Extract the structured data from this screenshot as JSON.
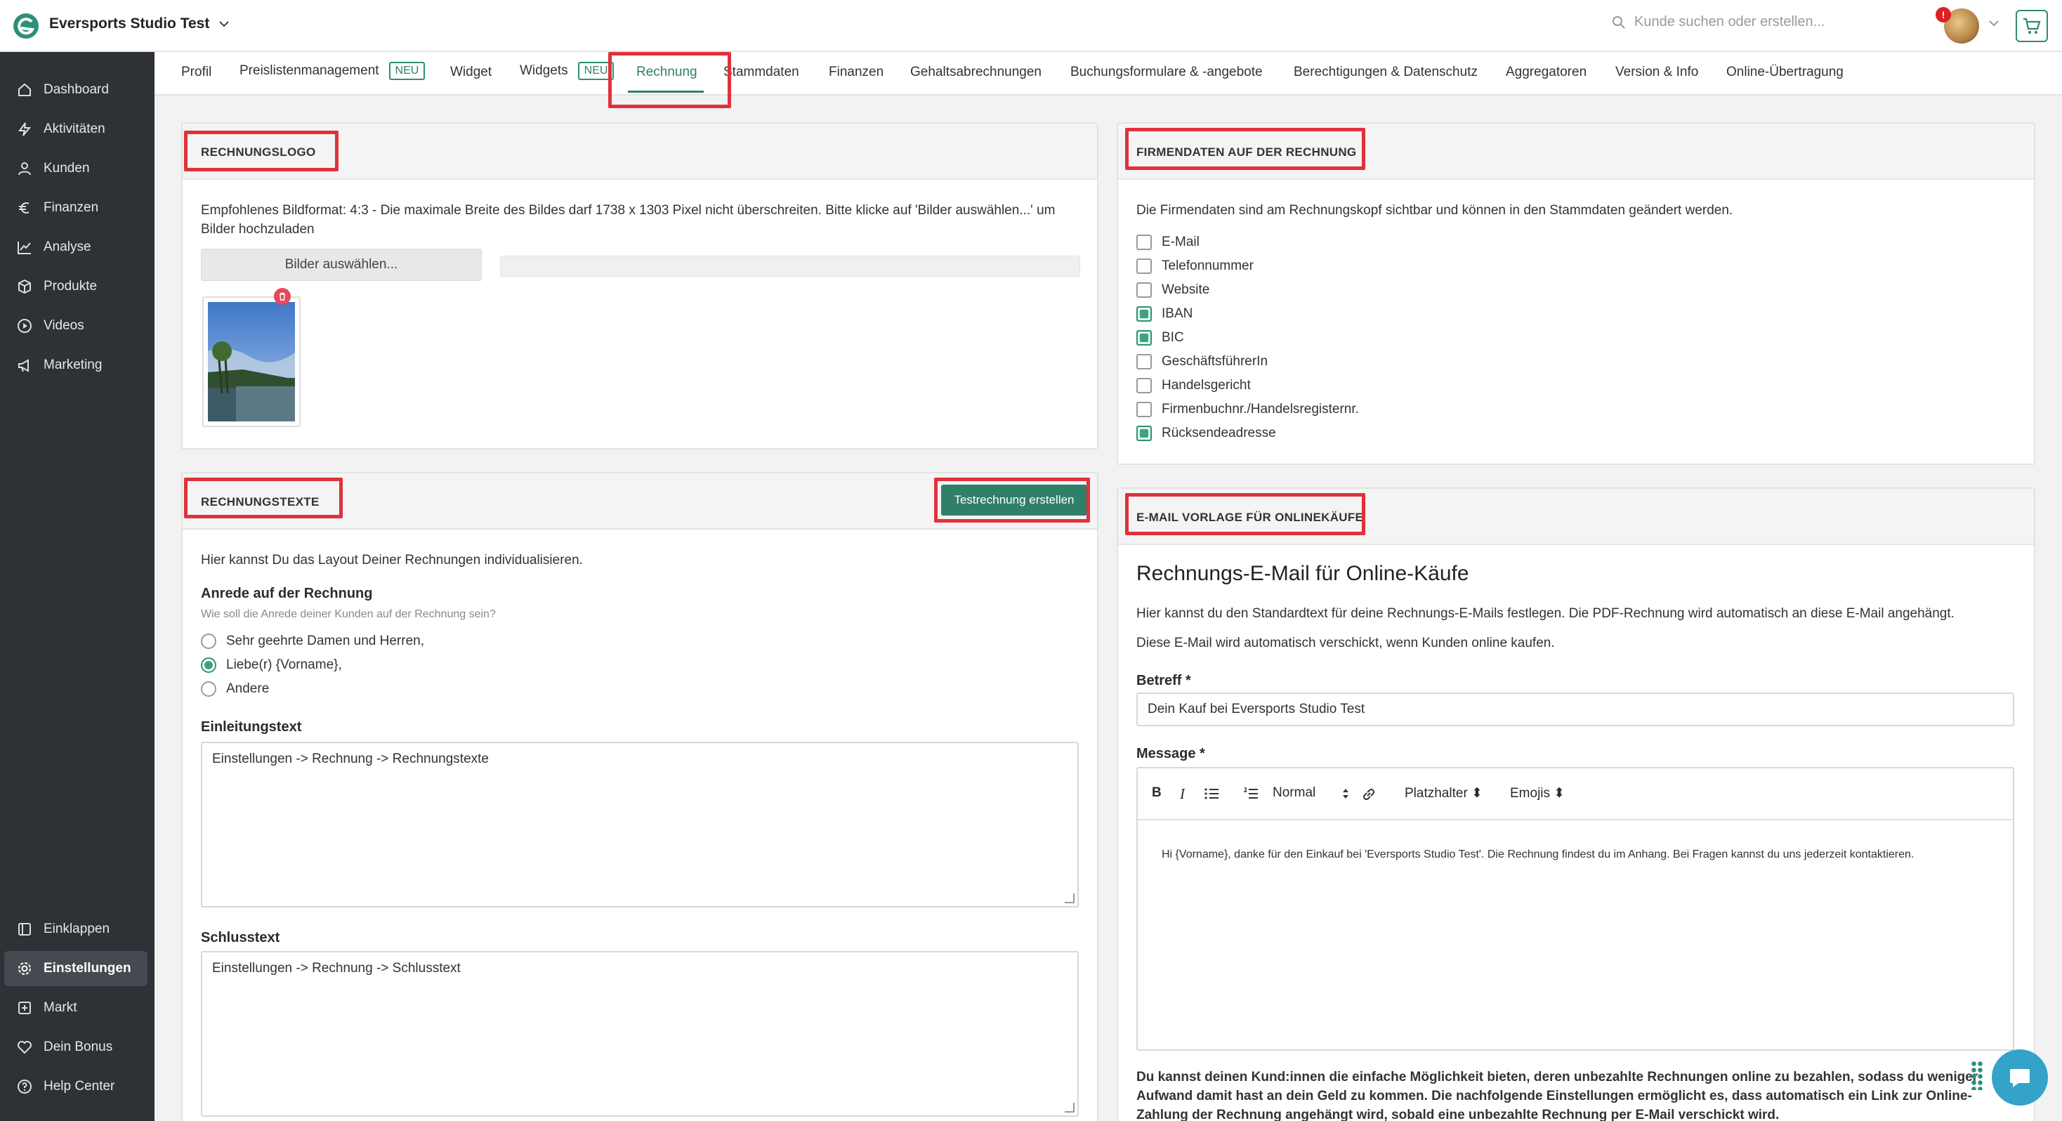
{
  "app": {
    "studio_name": "Eversports Studio Test"
  },
  "search": {
    "placeholder": "Kunde suchen oder erstellen..."
  },
  "notifications": {
    "count": "!"
  },
  "sidebar": {
    "items": [
      {
        "label": "Dashboard",
        "icon": "home-icon"
      },
      {
        "label": "Aktivitäten",
        "icon": "bolt-icon"
      },
      {
        "label": "Kunden",
        "icon": "user-icon"
      },
      {
        "label": "Finanzen",
        "icon": "euro-icon"
      },
      {
        "label": "Analyse",
        "icon": "chart-icon"
      },
      {
        "label": "Produkte",
        "icon": "box-icon"
      },
      {
        "label": "Videos",
        "icon": "play-icon"
      },
      {
        "label": "Marketing",
        "icon": "megaphone-icon"
      }
    ],
    "bottom": [
      {
        "label": "Einklappen",
        "icon": "collapse-icon"
      },
      {
        "label": "Einstellungen",
        "icon": "gear-icon"
      },
      {
        "label": "Markt",
        "icon": "plus-square-icon"
      },
      {
        "label": "Dein Bonus",
        "icon": "heart-icon"
      },
      {
        "label": "Help Center",
        "icon": "help-icon"
      }
    ]
  },
  "tabs": [
    {
      "label": "Profil"
    },
    {
      "label": "Preislistenmanagement",
      "badge": "NEU"
    },
    {
      "label": "Widget"
    },
    {
      "label": "Widgets",
      "badge": "NEU"
    },
    {
      "label": "Rechnung"
    },
    {
      "label": "Stammdaten"
    },
    {
      "label": "Finanzen"
    },
    {
      "label": "Gehaltsabrechnungen"
    },
    {
      "label": "Buchungsformulare & -angebote"
    },
    {
      "label": "Berechtigungen & Datenschutz"
    },
    {
      "label": "Aggregatoren"
    },
    {
      "label": "Version & Info"
    },
    {
      "label": "Online-Übertragung"
    }
  ],
  "logo_card": {
    "title": "RECHNUNGSLOGO",
    "description": "Empfohlenes Bildformat: 4:3 - Die maximale Breite des Bildes darf 1738 x 1303 Pixel nicht überschreiten. Bitte klicke auf 'Bilder auswählen...' um Bilder hochzuladen",
    "select_button": "Bilder auswählen..."
  },
  "texts_card": {
    "title": "RECHNUNGSTEXTE",
    "test_button": "Testrechnung erstellen",
    "intro": "Hier kannst Du das Layout Deiner Rechnungen individualisieren.",
    "salutation_label": "Anrede auf der Rechnung",
    "salutation_help": "Wie soll die Anrede deiner Kunden auf der Rechnung sein?",
    "salutation_options": [
      {
        "label": "Sehr geehrte Damen und Herren,",
        "selected": false
      },
      {
        "label": "Liebe(r) {Vorname},",
        "selected": true
      },
      {
        "label": "Andere",
        "selected": false
      }
    ],
    "intro_text_label": "Einleitungstext",
    "intro_text_value": "Einstellungen  -> Rechnung -> Rechnungstexte",
    "closing_text_label": "Schlusstext",
    "closing_text_value": "Einstellungen  -> Rechnung -> Schlusstext"
  },
  "company_card": {
    "title": "FIRMENDATEN AUF DER RECHNUNG",
    "description": "Die Firmendaten sind am Rechnungskopf sichtbar und können in den Stammdaten geändert werden.",
    "options": [
      {
        "label": "E-Mail",
        "checked": false
      },
      {
        "label": "Telefonnummer",
        "checked": false
      },
      {
        "label": "Website",
        "checked": false
      },
      {
        "label": "IBAN",
        "checked": true
      },
      {
        "label": "BIC",
        "checked": true
      },
      {
        "label": "GeschäftsführerIn",
        "checked": false
      },
      {
        "label": "Handelsgericht",
        "checked": false
      },
      {
        "label": "Firmenbuchnr./Handelsregisternr.",
        "checked": false
      },
      {
        "label": "Rücksendeadresse",
        "checked": true
      }
    ]
  },
  "email_card": {
    "title": "E-MAIL VORLAGE FÜR ONLINEKÄUFE",
    "heading": "Rechnungs-E-Mail für Online-Käufe",
    "line1": "Hier kannst du den Standardtext für deine Rechnungs-E-Mails festlegen. Die PDF-Rechnung wird automatisch an diese E-Mail angehängt.",
    "line2": "Diese E-Mail wird automatisch verschickt, wenn Kunden online kaufen.",
    "subject_label": "Betreff *",
    "subject_value": "Dein Kauf bei Eversports Studio Test",
    "message_label": "Message *",
    "toolbar": {
      "format": "Normal",
      "placeholder": "Platzhalter",
      "emojis": "Emojis"
    },
    "message_body": "Hi {Vorname}, danke für den Einkauf bei 'Eversports Studio Test'. Die Rechnung findest du im Anhang. Bei Fragen kannst du uns jederzeit kontaktieren.",
    "footer_text": "Du kannst deinen Kund:innen die einfache Möglichkeit bieten, deren unbezahlte Rechnungen online zu bezahlen, sodass du weniger Aufwand damit hast an dein Geld zu kommen. Die nachfolgende Einstellungen ermöglicht es, dass automatisch ein Link zur Online-Zahlung der Rechnung angehängt wird, sobald eine unbezahlte Rechnung per E-Mail verschickt wird."
  },
  "colors": {
    "accent": "#2f7f69",
    "highlight": "#e0313c",
    "sidebar": "#2e3135"
  }
}
